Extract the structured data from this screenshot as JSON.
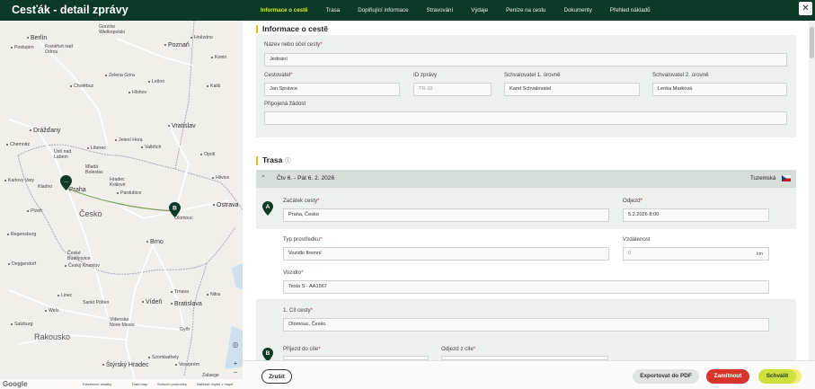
{
  "app": {
    "title": "Cesťák - detail zprávy",
    "close_label": "✕"
  },
  "nav": [
    {
      "label": "Informace o cestě",
      "active": true
    },
    {
      "label": "Trasa"
    },
    {
      "label": "Doplňující informace"
    },
    {
      "label": "Stravování"
    },
    {
      "label": "Výdaje"
    },
    {
      "label": "Peníze na cestu"
    },
    {
      "label": "Dokumenty"
    },
    {
      "label": "Přehled nákladů"
    }
  ],
  "map": {
    "cities": [
      "Berlín",
      "Postupim",
      "Frankfurt nad Odrou",
      "Gorzów Wielkopolski",
      "Hnězdno",
      "Poznaň",
      "Konin",
      "Zelena Góra",
      "Lešno",
      "Kališ",
      "Chotěbuz",
      "Hlohov",
      "Vratislav",
      "Drážďany",
      "Jelení Hora",
      "Chemnitz",
      "Liberec",
      "Valbřich",
      "Ústí nad Labem",
      "Opolí",
      "Mladá Boleslav",
      "Karlovy Vary",
      "Kladno",
      "Praha",
      "Hradec Králové",
      "Pardubice",
      "Hlivice",
      "Ostrava",
      "Plzeň",
      "Česko",
      "Olomouc",
      "Brno",
      "Regensburg",
      "Deggendorf",
      "České Budějovice",
      "Český Krumlov",
      "Trnava",
      "Nitra",
      "Linec",
      "Sankt Pölten",
      "Vídeň",
      "Bratislava",
      "Wels",
      "Salzburg",
      "Videnske Nove Mesto",
      "Győr",
      "Rakousko",
      "Szombathely",
      "Štýrský Hradec",
      "Veszprém",
      "Zalaege"
    ],
    "footer": [
      "Klávesové zkratky",
      "Data map",
      "Smluvní podmínky",
      "Nahlásit chybu v mapě"
    ],
    "google_logo": "Google",
    "marker_a": "...",
    "marker_b": "B"
  },
  "info": {
    "section_title": "Informace o cestě",
    "purpose_label": "Název nebo účel cesty",
    "purpose_value": "Jednání",
    "traveler_label": "Cestovatel",
    "traveler_value": "Jan Správce",
    "report_id_label": "ID zprávy",
    "report_id_value": "TR-10",
    "approver1_label": "Schvalovatel 1. úrovně",
    "approver1_value": "Karel Schvalovatel",
    "approver2_label": "Schvalovatel 2. úrovně",
    "approver2_value": "Lenka Marková",
    "request_label": "Připojená žádost",
    "request_value": ""
  },
  "route": {
    "section_title": "Trasa",
    "info_icon": "ⓘ",
    "trip_dates": "Čtv 6. - Pát 6. 2. 2026",
    "trip_type": "Tuzemská",
    "start_label": "Začátek cesty",
    "start_value": "Praha, Česko",
    "departure_label": "Odjezd",
    "departure_value": "5.2.2026 8:00",
    "vehicle_type_label": "Typ prostředku",
    "vehicle_type_value": "Vozidlo firemní",
    "distance_label": "Vzdálenost",
    "distance_value": "0",
    "distance_unit": "km",
    "vehicle_label": "Vozidlo",
    "vehicle_value": "Tesla S - AA1567",
    "dest_label": "1. Cíl cesty",
    "dest_value": "Olomouc, Česko",
    "arrival_label": "Příjezd do cíle",
    "departure_dest_label": "Odjezd z cíle",
    "marker_a": "A",
    "marker_b": "B"
  },
  "footer": {
    "cancel": "Zrušit",
    "export": "Exportovat do PDF",
    "reject": "Zamítnout",
    "approve": "Schválit"
  },
  "colors": {
    "brand_dark": "#0d3a26",
    "accent_yellow": "#d7e63a",
    "reject_red": "#d9342b",
    "approve_green": "#cde13e"
  }
}
